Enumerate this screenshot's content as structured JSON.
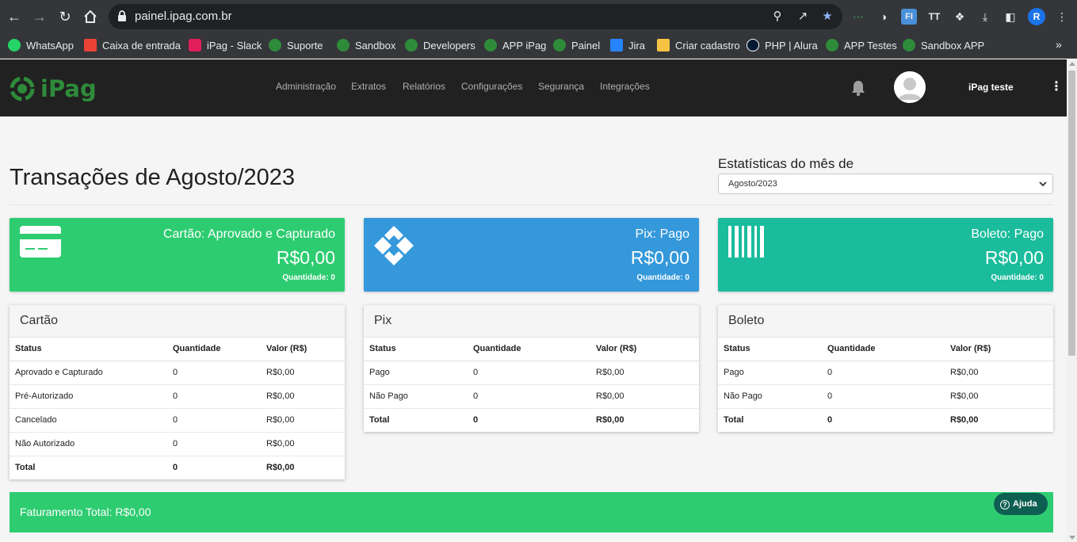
{
  "browser": {
    "url": "painel.ipag.com.br",
    "profile_initial": "R",
    "bookmarks": [
      {
        "label": "WhatsApp",
        "color": "#25d366"
      },
      {
        "label": "Caixa de entrada",
        "color": "#ea4335"
      },
      {
        "label": "iPag - Slack",
        "color": "#e01e5a"
      },
      {
        "label": "Suporte",
        "color": "#2e8b3a"
      },
      {
        "label": "Sandbox",
        "color": "#2e8b3a"
      },
      {
        "label": "Developers",
        "color": "#2e8b3a"
      },
      {
        "label": "APP iPag",
        "color": "#2e8b3a"
      },
      {
        "label": "Painel",
        "color": "#2e8b3a"
      },
      {
        "label": "Jira",
        "color": "#2684ff"
      },
      {
        "label": "Criar cadastro",
        "color": "#f6c343"
      },
      {
        "label": "PHP | Alura",
        "color": "#051933"
      },
      {
        "label": "APP Testes",
        "color": "#2e8b3a"
      },
      {
        "label": "Sandbox APP",
        "color": "#2e8b3a"
      }
    ],
    "bookmarks_more": "»"
  },
  "header": {
    "logo_text": "iPag",
    "nav": [
      "Administração",
      "Extratos",
      "Relatórios",
      "Configurações",
      "Segurança",
      "Integrações"
    ],
    "user_name": "iPag teste",
    "menu_glyph": "⋮"
  },
  "main": {
    "title": "Transações de Agosto/2023",
    "stats_label": "Estatísticas do mês de",
    "stats_selected": "Agosto/2023"
  },
  "summary_cards": [
    {
      "title": "Cartão: Aprovado e Capturado",
      "value": "R$0,00",
      "qty": "Quantidade: 0",
      "color": "#2ecc71",
      "icon": "credit-card-icon"
    },
    {
      "title": "Pix: Pago",
      "value": "R$0,00",
      "qty": "Quantidade: 0",
      "color": "#3498db",
      "icon": "pix-icon"
    },
    {
      "title": "Boleto: Pago",
      "value": "R$0,00",
      "qty": "Quantidade: 0",
      "color": "#1abc9c",
      "icon": "barcode-icon"
    }
  ],
  "panels": {
    "cartao": {
      "title": "Cartão",
      "headers": [
        "Status",
        "Quantidade",
        "Valor (R$)"
      ],
      "rows": [
        [
          "Aprovado e Capturado",
          "0",
          "R$0,00"
        ],
        [
          "Pré-Autorizado",
          "0",
          "R$0,00"
        ],
        [
          "Cancelado",
          "0",
          "R$0,00"
        ],
        [
          "Não Autorizado",
          "0",
          "R$0,00"
        ]
      ],
      "total": [
        "Total",
        "0",
        "R$0,00"
      ]
    },
    "pix": {
      "title": "Pix",
      "headers": [
        "Status",
        "Quantidade",
        "Valor (R$)"
      ],
      "rows": [
        [
          "Pago",
          "0",
          "R$0,00"
        ],
        [
          "Não Pago",
          "0",
          "R$0,00"
        ]
      ],
      "total": [
        "Total",
        "0",
        "R$0,00"
      ]
    },
    "boleto": {
      "title": "Boleto",
      "headers": [
        "Status",
        "Quantidade",
        "Valor (R$)"
      ],
      "rows": [
        [
          "Pago",
          "0",
          "R$0,00"
        ],
        [
          "Não Pago",
          "0",
          "R$0,00"
        ]
      ],
      "total": [
        "Total",
        "0",
        "R$0,00"
      ]
    }
  },
  "footer": {
    "total_label": "Faturamento Total: R$0,00",
    "help_label": "Ajuda"
  }
}
